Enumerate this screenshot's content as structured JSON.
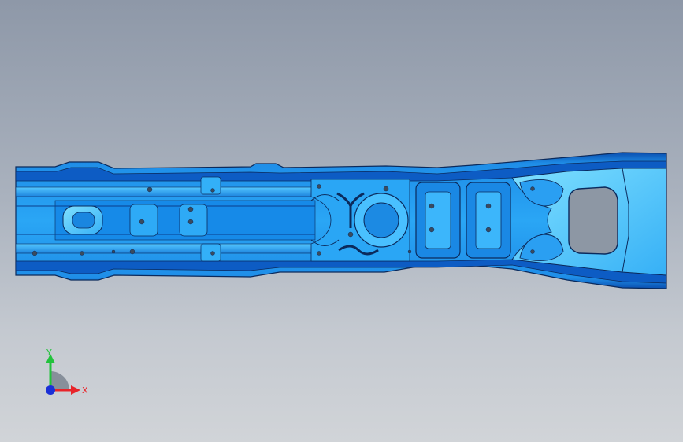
{
  "viewport": {
    "background_top": "#8e98a8",
    "background_bottom": "#d1d4d8"
  },
  "model": {
    "name": "",
    "colors": {
      "body": "#1e8fe6",
      "dark": "#0a52b8",
      "light": "#4cc2ff",
      "outline": "#0b2a5c",
      "hole": "#3b4b5e",
      "cutout": "#8d97a4"
    }
  },
  "triad": {
    "x_label": "X",
    "y_label": "Y",
    "x_color": "#e8242a",
    "y_color": "#22c23c",
    "z_color": "#1a2fd6",
    "arc_color": "#7f8894"
  }
}
